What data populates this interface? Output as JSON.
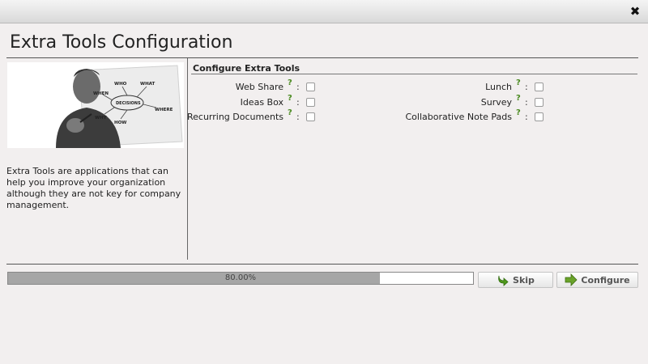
{
  "window": {
    "close_symbol": "✖"
  },
  "page": {
    "title": "Extra Tools Configuration"
  },
  "left_panel": {
    "description": "Extra Tools are applications that can help you improve your organization although they are not key for company management.",
    "photo_words": [
      "WHO",
      "WHAT",
      "WHEN",
      "DECISIONS",
      "WHERE",
      "WHY",
      "HOW"
    ]
  },
  "section": {
    "title": "Configure Extra Tools"
  },
  "tools": {
    "help_symbol": "?",
    "colon": ":",
    "left": [
      {
        "label": "Web Share",
        "checked": false
      },
      {
        "label": "Ideas Box",
        "checked": false
      },
      {
        "label": "Recurring Documents",
        "checked": false
      }
    ],
    "right": [
      {
        "label": "Lunch",
        "checked": false
      },
      {
        "label": "Survey",
        "checked": false
      },
      {
        "label": "Collaborative Note Pads",
        "checked": false
      }
    ]
  },
  "progress": {
    "value": 0.8,
    "label": "80.00%"
  },
  "buttons": {
    "skip": "Skip",
    "configure": "Configure"
  },
  "colors": {
    "help": "#4a8a20",
    "skip_icon": "#4f9a1c",
    "configure_icon": "#6aa32a"
  }
}
